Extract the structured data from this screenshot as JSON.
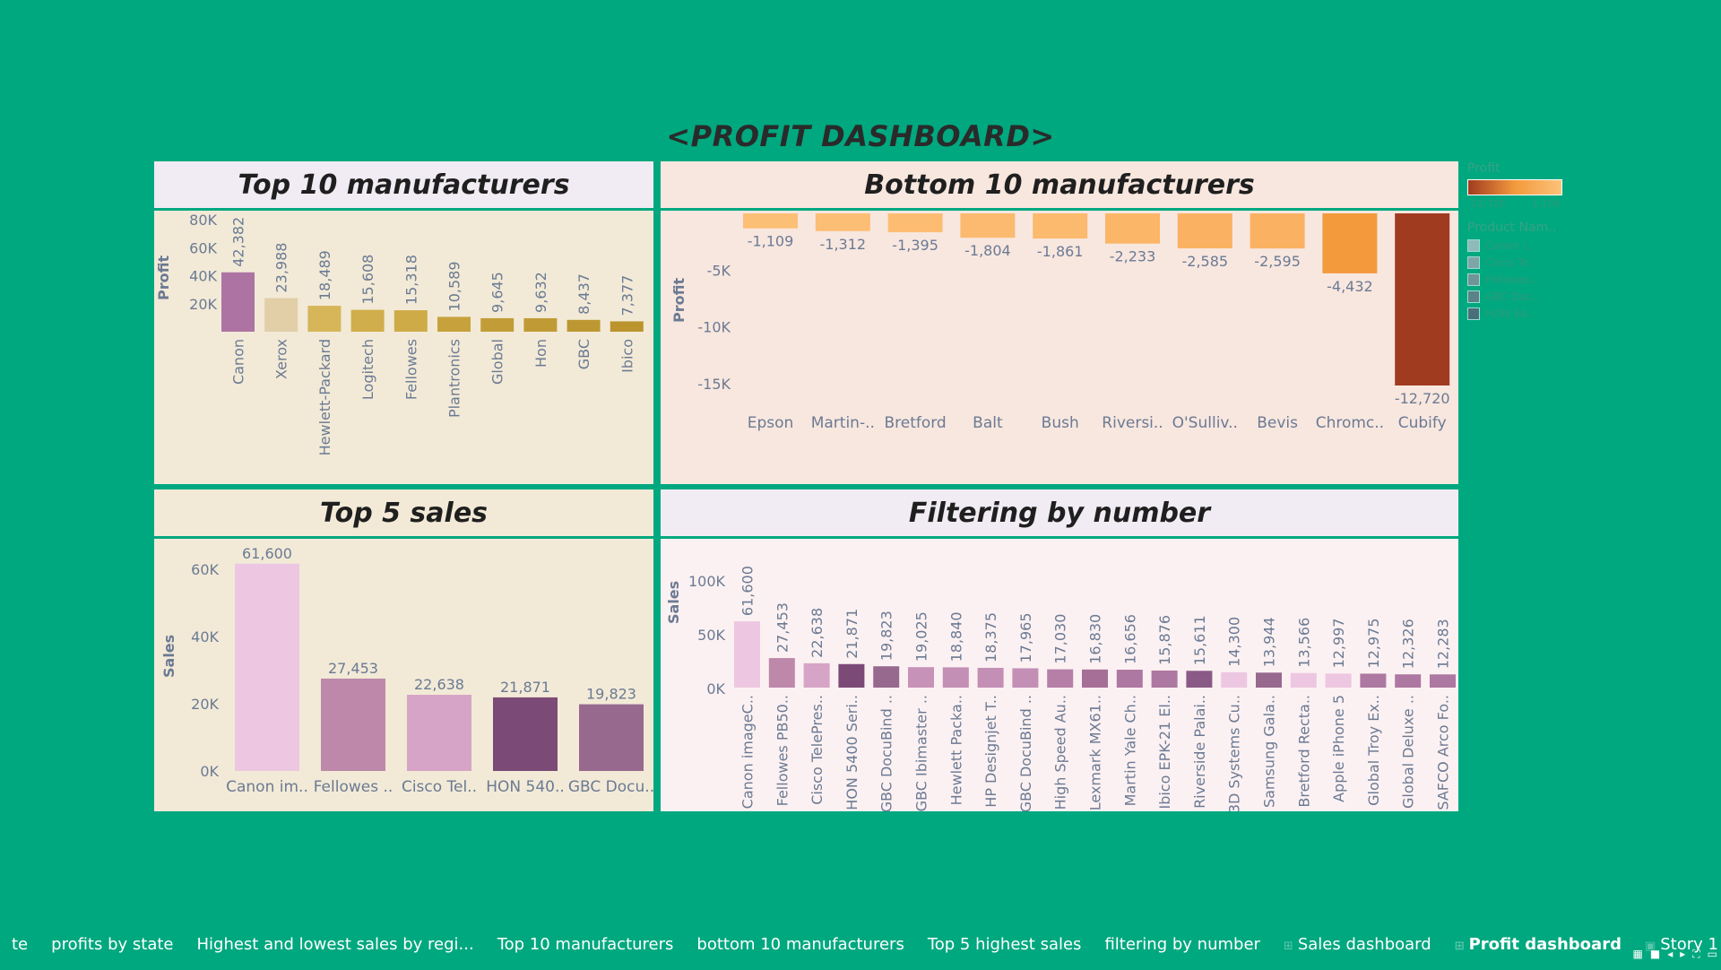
{
  "dashboard_title": "<PROFIT DASHBOARD>",
  "colors": {
    "background": "#00a87f",
    "top_panel_bg": "#f2ead7",
    "top_head_bg": "#f1ecf3",
    "bottom_panel_bg": "#f8e7df",
    "pink_panel_bg": "#fcf1f2"
  },
  "panels": {
    "top10": {
      "title": "Top 10 manufacturers"
    },
    "bottom10": {
      "title": "Bottom 10 manufacturers"
    },
    "top5": {
      "title": "Top 5 sales"
    },
    "filter": {
      "title": "Filtering by number"
    }
  },
  "legend": {
    "profit_title": "Profit",
    "profit_min": "-12,720",
    "profit_max": "-1,109",
    "product_title": "Product Nam..",
    "product_items": [
      "Canon i..",
      "Cisco Te..",
      "Fellowes..",
      "GBC Doc..",
      "HON 54.."
    ],
    "product_colors": [
      "#edc7e1",
      "#d6a4c6",
      "#bd88aa",
      "#98698f",
      "#7b4a77"
    ]
  },
  "tabs": [
    {
      "label": "te",
      "icon": ""
    },
    {
      "label": "profits by state",
      "icon": ""
    },
    {
      "label": "Highest and lowest sales by regi...",
      "icon": ""
    },
    {
      "label": "Top 10 manufacturers",
      "icon": ""
    },
    {
      "label": "bottom 10 manufacturers",
      "icon": ""
    },
    {
      "label": "Top 5 highest sales",
      "icon": ""
    },
    {
      "label": "filtering by number",
      "icon": ""
    },
    {
      "label": "Sales dashboard",
      "icon": "grid-icon"
    },
    {
      "label": "Profit dashboard",
      "icon": "grid-icon",
      "active": true
    },
    {
      "label": "Story 1",
      "icon": "story-icon"
    }
  ],
  "chart_data": [
    {
      "type": "bar",
      "title": "Top 10 manufacturers",
      "ylabel": "Profit",
      "ylim": [
        0,
        80000
      ],
      "yticks": [
        "80K",
        "60K",
        "40K",
        "20K"
      ],
      "categories": [
        "Canon",
        "Xerox",
        "Hewlett-Packard",
        "Logitech",
        "Fellowes",
        "Plantronics",
        "Global",
        "Hon",
        "GBC",
        "Ibico"
      ],
      "values": [
        42382,
        23988,
        18489,
        15608,
        15318,
        10589,
        9645,
        9632,
        8437,
        7377
      ],
      "labels": [
        "42,382",
        "23,988",
        "18,489",
        "15,608",
        "15,318",
        "10,589",
        "9,645",
        "9,632",
        "8,437",
        "7,377"
      ],
      "colors": [
        "#ad74a3",
        "#e2cfa8",
        "#d6b659",
        "#d1ae4c",
        "#cfab48",
        "#c7a23c",
        "#c29d37",
        "#c09b35",
        "#bd9731",
        "#bb942e"
      ]
    },
    {
      "type": "bar",
      "title": "Bottom 10 manufacturers",
      "ylabel": "Profit",
      "ylim": [
        -12720,
        0
      ],
      "yticks": [
        "-5K",
        "-10K",
        "-15K"
      ],
      "categories": [
        "Epson",
        "Martin-..",
        "Bretford",
        "Balt",
        "Bush",
        "Riversi..",
        "O'Sulliv..",
        "Bevis",
        "Chromc..",
        "Cubify"
      ],
      "values": [
        -1109,
        -1312,
        -1395,
        -1804,
        -1861,
        -2233,
        -2585,
        -2595,
        -4432,
        -12720
      ],
      "labels": [
        "-1,109",
        "-1,312",
        "-1,395",
        "-1,804",
        "-1,861",
        "-2,233",
        "-2,585",
        "-2,595",
        "-4,432",
        "-12,720"
      ],
      "colors": [
        "#fcbf76",
        "#fcbe74",
        "#fcbd73",
        "#fbba6f",
        "#fbba6e",
        "#fbb668",
        "#fab262",
        "#fab262",
        "#f39a3d",
        "#a13b20"
      ]
    },
    {
      "type": "bar",
      "title": "Top 5 sales",
      "ylabel": "Sales",
      "ylim": [
        0,
        65000
      ],
      "yticks": [
        "60K",
        "40K",
        "20K",
        "0K"
      ],
      "categories": [
        "Canon im..",
        "Fellowes ..",
        "Cisco Tel..",
        "HON 540..",
        "GBC Docu.."
      ],
      "values": [
        61600,
        27453,
        22638,
        21871,
        19823
      ],
      "labels": [
        "61,600",
        "27,453",
        "22,638",
        "21,871",
        "19,823"
      ],
      "colors": [
        "#edc7e1",
        "#bd88aa",
        "#d6a4c6",
        "#7b4a77",
        "#98698f"
      ]
    },
    {
      "type": "bar",
      "title": "Filtering by number",
      "ylabel": "Sales",
      "ylim": [
        0,
        100000
      ],
      "yticks": [
        "100K",
        "50K",
        "0K"
      ],
      "categories": [
        "Canon imageC..",
        "Fellowes PB50..",
        "Cisco TelePres..",
        "HON 5400 Seri..",
        "GBC DocuBind ..",
        "GBC Ibimaster ..",
        "Hewlett Packa..",
        "HP Designjet T..",
        "GBC DocuBind ..",
        "High Speed Au..",
        "Lexmark MX61..",
        "Martin Yale Ch..",
        "Ibico EPK-21 El..",
        "Riverside Palai..",
        "3D Systems Cu..",
        "Samsung Gala..",
        "Bretford Recta..",
        "Apple iPhone 5",
        "Global Troy Ex..",
        "Global Deluxe ..",
        "SAFCO Arco Fo.."
      ],
      "values": [
        61600,
        27453,
        22638,
        21871,
        19823,
        19025,
        18840,
        18375,
        17965,
        17030,
        16830,
        16656,
        15876,
        15611,
        14300,
        13944,
        13566,
        12997,
        12975,
        12326,
        12283
      ],
      "labels": [
        "61,600",
        "27,453",
        "22,638",
        "21,871",
        "19,823",
        "19,025",
        "18,840",
        "18,375",
        "17,965",
        "17,030",
        "16,830",
        "16,656",
        "15,876",
        "15,611",
        "14,300",
        "13,944",
        "13,566",
        "12,997",
        "12,975",
        "12,326",
        "12,283"
      ],
      "colors": [
        "#edc7e1",
        "#bd88aa",
        "#d6a4c6",
        "#7b4a77",
        "#98698f",
        "#c792b8",
        "#c38fb5",
        "#c38fb5",
        "#c38fb5",
        "#b67fa7",
        "#a56f98",
        "#ad78a1",
        "#ad78a1",
        "#8a5a86",
        "#edc7e1",
        "#98698f",
        "#edc7e1",
        "#edc7e1",
        "#ad78a1",
        "#ad78a1",
        "#ad78a1"
      ]
    }
  ]
}
